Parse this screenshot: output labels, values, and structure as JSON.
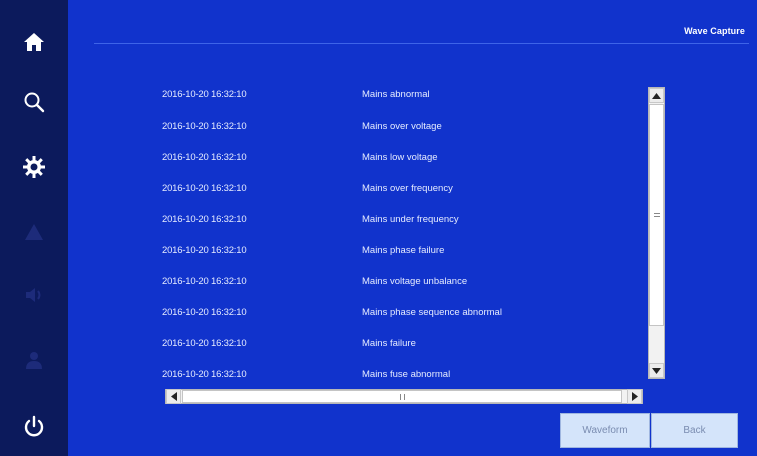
{
  "header": {
    "title": "Wave Capture"
  },
  "sidebar": {
    "items": [
      {
        "icon": "home-icon"
      },
      {
        "icon": "search-icon"
      },
      {
        "icon": "gear-icon"
      },
      {
        "icon": "warning-icon"
      },
      {
        "icon": "speaker-icon"
      },
      {
        "icon": "user-icon"
      },
      {
        "icon": "power-icon"
      }
    ]
  },
  "events": [
    {
      "time": "2016-10-20 16:32:10",
      "description": "Mains abnormal"
    },
    {
      "time": "2016-10-20 16:32:10",
      "description": "Mains over voltage"
    },
    {
      "time": "2016-10-20 16:32:10",
      "description": "Mains low voltage"
    },
    {
      "time": "2016-10-20 16:32:10",
      "description": "Mains over frequency"
    },
    {
      "time": "2016-10-20 16:32:10",
      "description": "Mains under frequency"
    },
    {
      "time": "2016-10-20 16:32:10",
      "description": "Mains phase failure"
    },
    {
      "time": "2016-10-20 16:32:10",
      "description": "Mains voltage unbalance"
    },
    {
      "time": "2016-10-20 16:32:10",
      "description": "Mains phase sequence abnormal"
    },
    {
      "time": "2016-10-20 16:32:10",
      "description": "Mains failure"
    },
    {
      "time": "2016-10-20 16:32:10",
      "description": "Mains fuse abnormal"
    }
  ],
  "buttons": {
    "waveform": "Waveform",
    "back": "Back"
  },
  "colors": {
    "background": "#1133cc",
    "sidebar": "#0c1a5c",
    "button": "#d4e4fa"
  }
}
